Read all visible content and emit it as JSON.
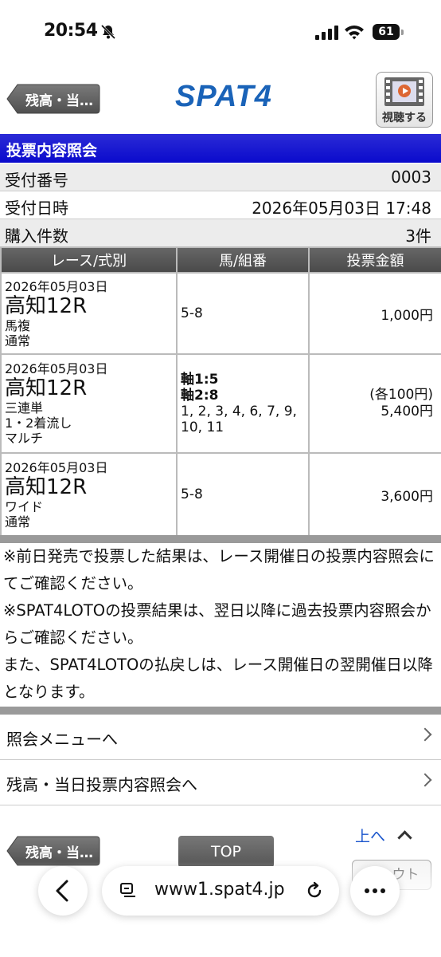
{
  "status": {
    "time": "20:54",
    "battery": "61"
  },
  "header": {
    "back_label": "残高・当…",
    "logo": "SPAT4",
    "watch_label": "視聴する"
  },
  "title": "投票内容照会",
  "info": [
    {
      "label": "受付番号",
      "value": "0003"
    },
    {
      "label": "受付日時",
      "value": "2026年05月03日 17:48"
    },
    {
      "label": "購入件数",
      "value": "3件"
    }
  ],
  "table": {
    "headers": [
      "レース/式別",
      "馬/組番",
      "投票金額"
    ],
    "rows": [
      {
        "date": "2026年05月03日",
        "venue": "高知12R",
        "type": "馬複",
        "method": "通常",
        "combo": "5-8",
        "amount": "1,000円"
      },
      {
        "date": "2026年05月03日",
        "venue": "高知12R",
        "type": "三連単",
        "method": "1・2着流し",
        "method2": "マルチ",
        "axis1": "軸1:5",
        "axis2": "軸2:8",
        "partners": "1, 2, 3, 4, 6, 7, 9, 10, 11",
        "amount_each": "(各100円)",
        "amount": "5,400円"
      },
      {
        "date": "2026年05月03日",
        "venue": "高知12R",
        "type": "ワイド",
        "method": "通常",
        "combo": "5-8",
        "amount": "3,600円"
      }
    ]
  },
  "notes": [
    "※前日発売で投票した結果は、レース開催日の投票内容照会にてご確認ください。",
    "※SPAT4LOTOの投票結果は、翌日以降に過去投票内容照会からご確認ください。",
    "また、SPAT4LOTOの払戻しは、レース開催日の翌開催日以降となります。"
  ],
  "menu": [
    {
      "label": "照会メニューへ"
    },
    {
      "label": "残高・当日投票内容照会へ"
    }
  ],
  "footer": {
    "back_label": "残高・当…",
    "top_label": "TOP",
    "up_label": "上へ",
    "logout_label": "ウト"
  },
  "browser": {
    "url": "www1.spat4.jp"
  },
  "colors": {
    "title_bar": "#0a0acc",
    "logo": "#1a63b8",
    "link": "#1a55cc"
  }
}
